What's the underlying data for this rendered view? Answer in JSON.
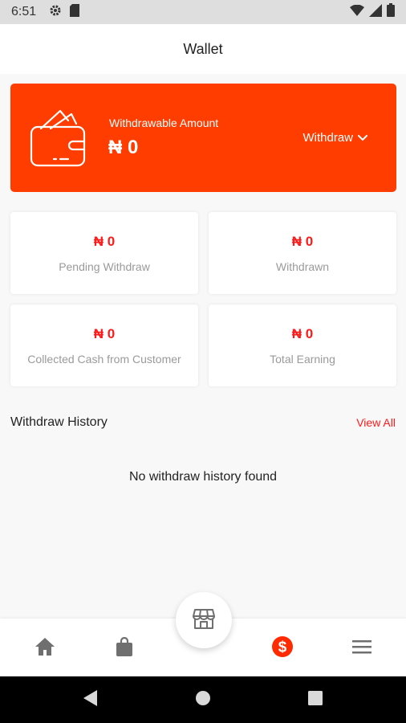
{
  "status_bar": {
    "time": "6:51",
    "icons": [
      "settings-icon",
      "sd-card-icon",
      "wifi-icon",
      "signal-icon",
      "battery-icon"
    ]
  },
  "header": {
    "title": "Wallet"
  },
  "balance": {
    "label": "Withdrawable Amount",
    "value": "₦ 0",
    "withdraw_label": "Withdraw"
  },
  "stats": [
    {
      "value": "₦ 0",
      "label": "Pending Withdraw"
    },
    {
      "value": "₦ 0",
      "label": "Withdrawn"
    },
    {
      "value": "₦ 0",
      "label": "Collected Cash from Customer"
    },
    {
      "value": "₦ 0",
      "label": "Total Earning"
    }
  ],
  "history": {
    "title": "Withdraw History",
    "view_all": "View All",
    "empty_message": "No withdraw history found"
  },
  "bottom_nav": {
    "items": [
      "home-icon",
      "shopping-bag-icon",
      "store-icon",
      "dollar-icon",
      "menu-icon"
    ],
    "active": "dollar-icon"
  },
  "colors": {
    "accent": "#ff3d00",
    "value_red": "#ff1a1a",
    "muted_text": "#9a9a9a",
    "nav_icon": "#6f6f6f"
  }
}
